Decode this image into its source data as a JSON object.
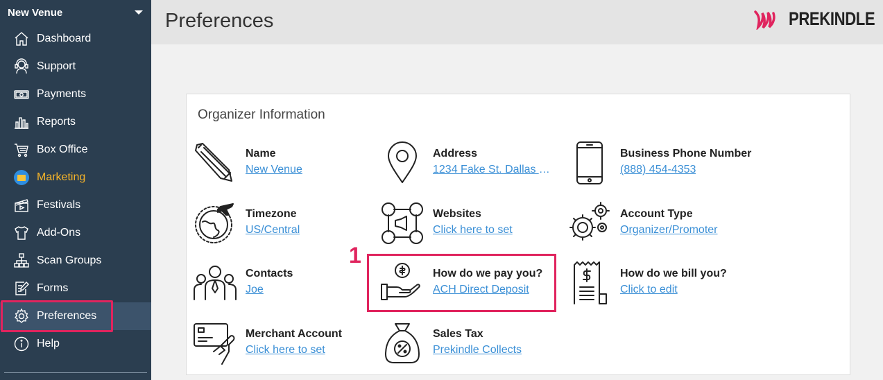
{
  "sidebar": {
    "venue": "New Venue",
    "items": [
      {
        "label": "Dashboard",
        "icon": "home-icon"
      },
      {
        "label": "Support",
        "icon": "headset-icon"
      },
      {
        "label": "Payments",
        "icon": "money-icon"
      },
      {
        "label": "Reports",
        "icon": "bar-chart-icon"
      },
      {
        "label": "Box Office",
        "icon": "cart-icon"
      },
      {
        "label": "Marketing",
        "icon": "mail-icon"
      },
      {
        "label": "Festivals",
        "icon": "clapper-icon"
      },
      {
        "label": "Add-Ons",
        "icon": "shirt-icon"
      },
      {
        "label": "Scan Groups",
        "icon": "hierarchy-icon"
      },
      {
        "label": "Forms",
        "icon": "form-edit-icon"
      },
      {
        "label": "Preferences",
        "icon": "gear-icon"
      },
      {
        "label": "Help",
        "icon": "info-icon"
      }
    ]
  },
  "header": {
    "title": "Preferences",
    "logo_text": "PREKINDLE"
  },
  "card": {
    "title": "Organizer Information",
    "items": [
      {
        "label": "Name",
        "value": "New Venue",
        "icon": "pen-icon"
      },
      {
        "label": "Address",
        "value": "1234 Fake St. Dallas T...",
        "icon": "map-pin-icon"
      },
      {
        "label": "Business Phone Number",
        "value": "(888) 454-4353",
        "icon": "phone-icon"
      },
      {
        "label": "Timezone",
        "value": "US/Central",
        "icon": "globe-plane-icon"
      },
      {
        "label": "Websites",
        "value": "Click here to set",
        "icon": "social-network-icon"
      },
      {
        "label": "Account Type",
        "value": "Organizer/Promoter",
        "icon": "gears-icon"
      },
      {
        "label": "Contacts",
        "value": "Joe",
        "icon": "people-icon"
      },
      {
        "label": "How do we pay you?",
        "value": "ACH Direct Deposit",
        "icon": "hand-coin-icon"
      },
      {
        "label": "How do we bill you?",
        "value": "Click to edit",
        "icon": "receipt-icon"
      },
      {
        "label": "Merchant Account",
        "value": "Click here to set",
        "icon": "credit-card-icon"
      },
      {
        "label": "Sales Tax",
        "value": "Prekindle Collects",
        "icon": "tax-bag-icon"
      }
    ]
  },
  "annotation": {
    "step": "1"
  },
  "colors": {
    "sidebar_bg": "#2b3e50",
    "active_bg": "#3c536b",
    "highlight": "#e0245e",
    "link": "#3a8fd6",
    "marketing": "#f6b429"
  }
}
